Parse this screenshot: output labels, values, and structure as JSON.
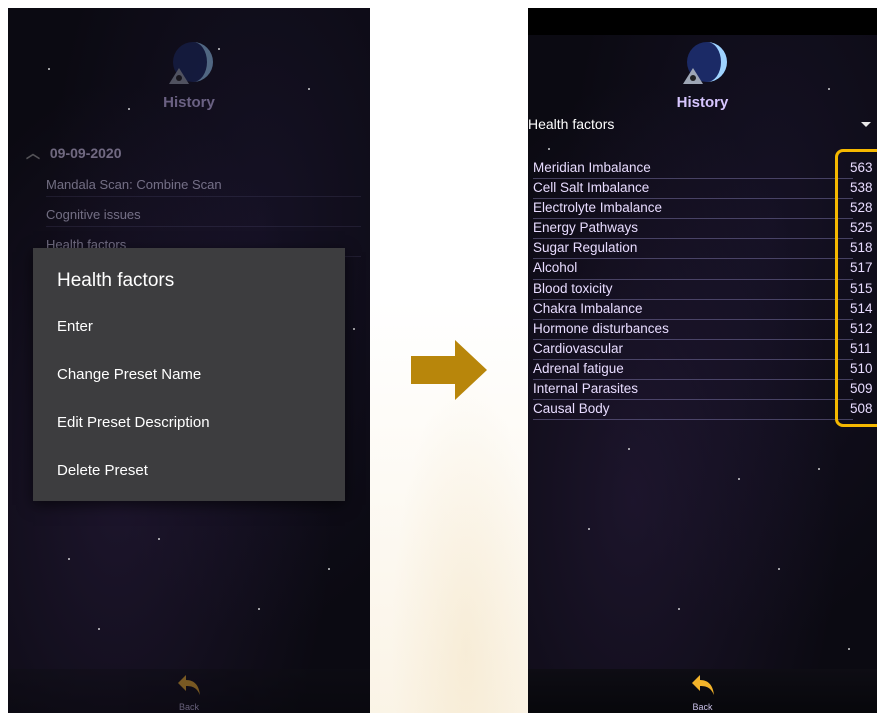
{
  "colors": {
    "highlight": "#f5b800",
    "arrow": "#b8860b",
    "dialog_bg": "#3d3d3f"
  },
  "left_screen": {
    "title": "History",
    "history": {
      "date": "09-09-2020",
      "items": [
        "Mandala Scan: Combine Scan",
        "Cognitive issues",
        "Health factors"
      ]
    },
    "dialog": {
      "title": "Health factors",
      "items": [
        "Enter",
        "Change Preset Name",
        "Edit Preset Description",
        "Delete Preset"
      ]
    },
    "back_label": "Back"
  },
  "right_screen": {
    "title": "History",
    "section": "Health factors",
    "factors": [
      {
        "name": "Meridian Imbalance",
        "value": "563"
      },
      {
        "name": "Cell Salt Imbalance",
        "value": "538"
      },
      {
        "name": "Electrolyte Imbalance",
        "value": "528"
      },
      {
        "name": "Energy Pathways",
        "value": "525"
      },
      {
        "name": "Sugar Regulation",
        "value": "518"
      },
      {
        "name": "Alcohol",
        "value": "517"
      },
      {
        "name": "Blood toxicity",
        "value": "515"
      },
      {
        "name": "Chakra Imbalance",
        "value": "514"
      },
      {
        "name": "Hormone disturbances",
        "value": "512"
      },
      {
        "name": "Cardiovascular",
        "value": "511"
      },
      {
        "name": "Adrenal fatigue",
        "value": "510"
      },
      {
        "name": "Internal Parasites",
        "value": "509"
      },
      {
        "name": "Causal Body",
        "value": "508"
      }
    ],
    "back_label": "Back"
  },
  "icons": {
    "logo": "planet-eye-logo-icon",
    "back": "back-arrow-icon",
    "chevron": "chevron-up-icon",
    "dropdown": "dropdown-triangle-icon",
    "transition": "right-arrow-icon"
  }
}
